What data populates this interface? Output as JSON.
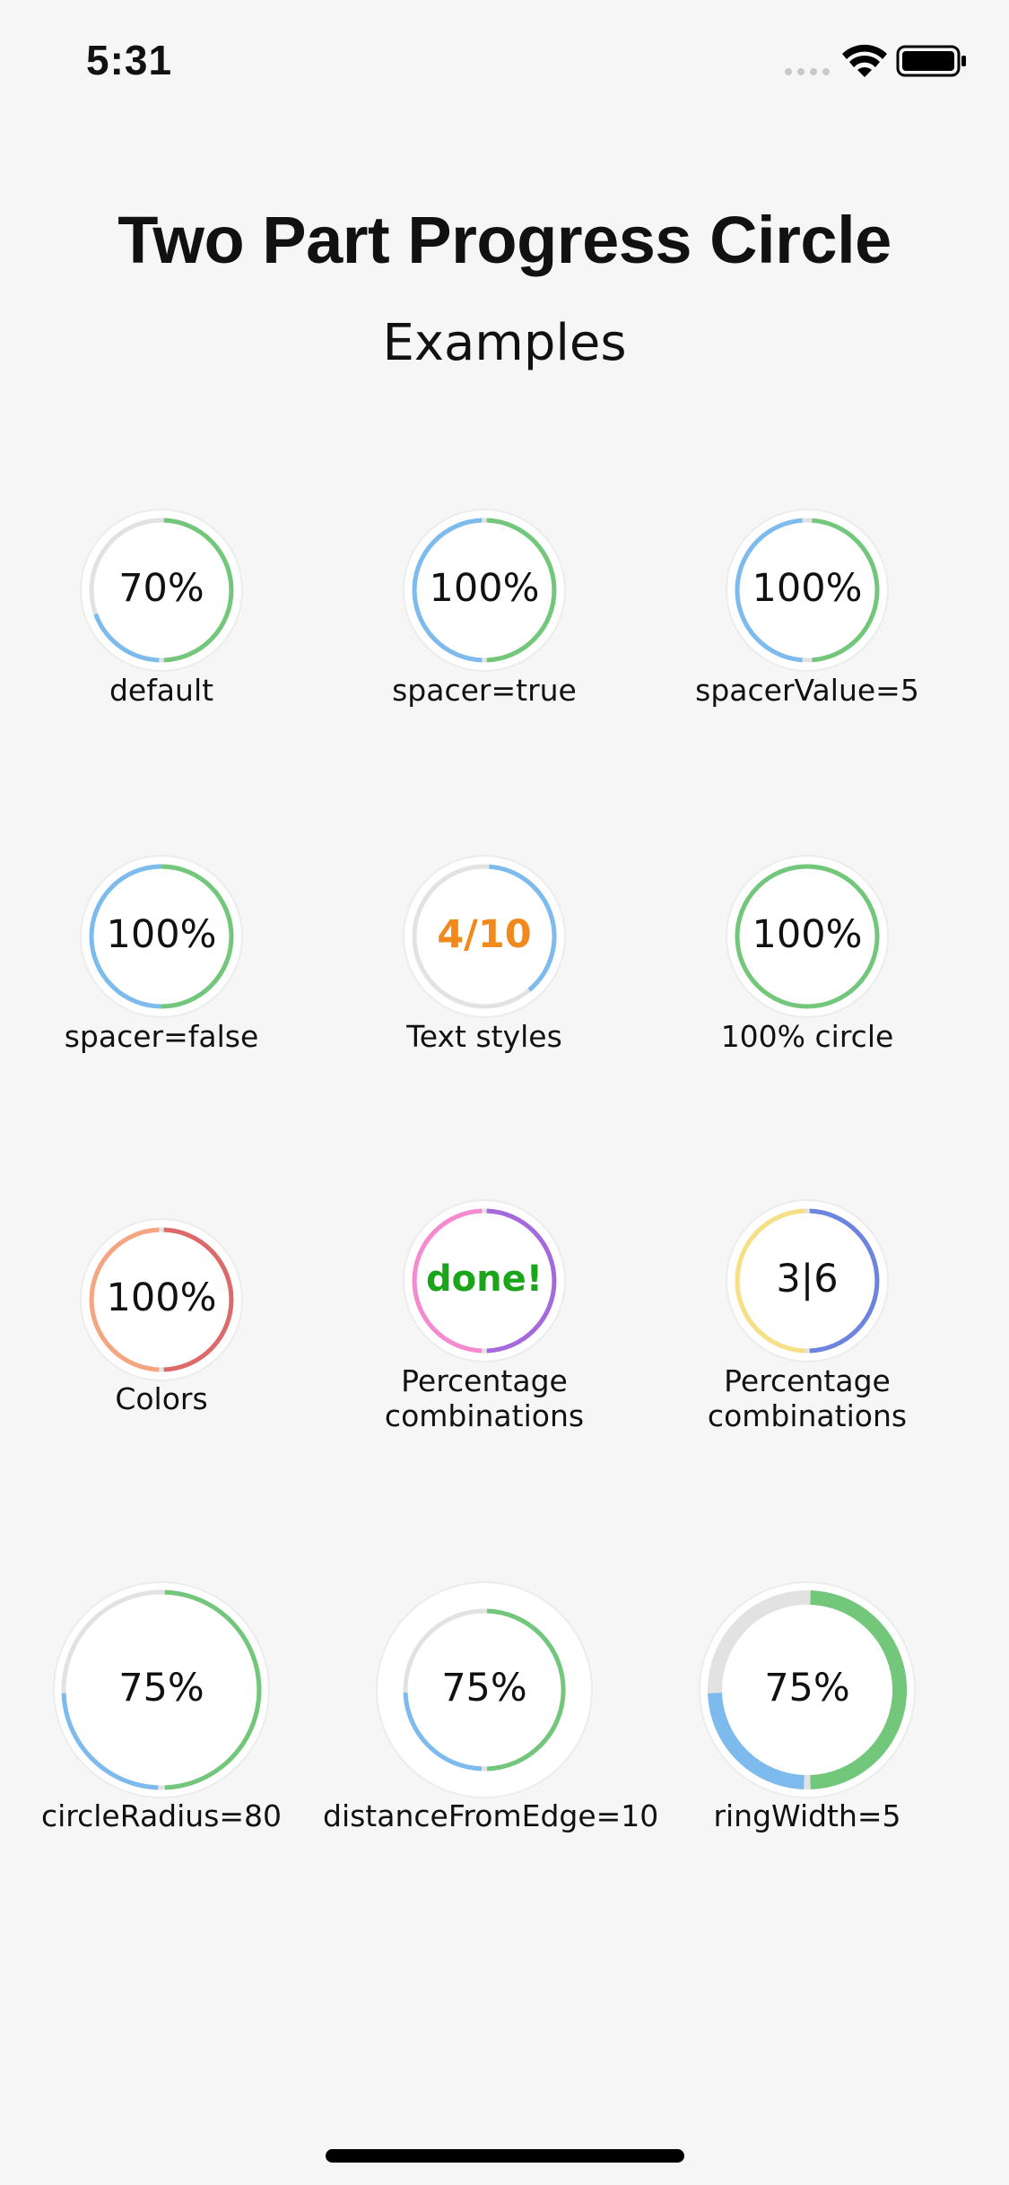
{
  "status_bar": {
    "time": "5:31",
    "icons": [
      "signal-icon",
      "wifi-icon",
      "battery-icon"
    ]
  },
  "header": {
    "title": "Two Part Progress Circle",
    "subtitle": "Examples"
  },
  "examples": [
    {
      "name": "default",
      "display": "70%",
      "label": "default",
      "progress": 0.7,
      "colors": [
        "#7dbbee",
        "#72c77b"
      ],
      "text_color": "#111111",
      "text_weight": "normal"
    },
    {
      "name": "spacer-true",
      "display": "100%",
      "label": "spacer=true",
      "progress": 1.0,
      "colors": [
        "#7dbbee",
        "#72c77b"
      ],
      "text_color": "#111111",
      "text_weight": "normal"
    },
    {
      "name": "spacer-value-5",
      "display": "100%",
      "label": "spacerValue=5",
      "progress": 1.0,
      "colors": [
        "#7dbbee",
        "#72c77b"
      ],
      "text_color": "#111111",
      "text_weight": "normal"
    },
    {
      "name": "spacer-false",
      "display": "100%",
      "label": "spacer=false",
      "progress": 1.0,
      "colors": [
        "#7dbbee",
        "#72c77b"
      ],
      "text_color": "#111111",
      "text_weight": "normal"
    },
    {
      "name": "text-styles",
      "display": "4/10",
      "label": "Text styles",
      "progress": 0.4,
      "colors": [
        "#7dbbee"
      ],
      "text_color": "#f08a1c",
      "text_weight": "bold"
    },
    {
      "name": "full-circle",
      "display": "100%",
      "label": "100% circle",
      "progress": 1.0,
      "colors": [
        "#72c77b"
      ],
      "text_color": "#111111",
      "text_weight": "normal"
    },
    {
      "name": "colors",
      "display": "100%",
      "label": "Colors",
      "progress": 1.0,
      "colors": [
        "#f3a67f",
        "#dd6a6a"
      ],
      "text_color": "#111111",
      "text_weight": "normal"
    },
    {
      "name": "percentage-combinations-1",
      "display": "done!",
      "label": "Percentage combinations",
      "progress": 1.0,
      "colors": [
        "#f58ad0",
        "#a569de"
      ],
      "text_color": "#1aa51a",
      "text_weight": "bold"
    },
    {
      "name": "percentage-combinations-2",
      "display": "3|6",
      "label": "Percentage combinations",
      "progress": 1.0,
      "colors": [
        "#f7df86",
        "#6a84e0"
      ],
      "text_color": "#111111",
      "text_weight": "normal"
    },
    {
      "name": "circle-radius-80",
      "display": "75%",
      "label": "circleRadius=80",
      "progress": 0.75,
      "colors": [
        "#7dbbee",
        "#72c77b"
      ],
      "text_color": "#111111",
      "text_weight": "normal"
    },
    {
      "name": "distance-from-edge-10",
      "display": "75%",
      "label": "distanceFromEdge=10",
      "progress": 0.75,
      "colors": [
        "#7dbbee",
        "#72c77b"
      ],
      "text_color": "#111111",
      "text_weight": "normal"
    },
    {
      "name": "ring-width-5",
      "display": "75%",
      "label": "ringWidth=5",
      "progress": 0.75,
      "colors": [
        "#7dbbee",
        "#72c77b"
      ],
      "text_color": "#111111",
      "text_weight": "normal"
    }
  ]
}
